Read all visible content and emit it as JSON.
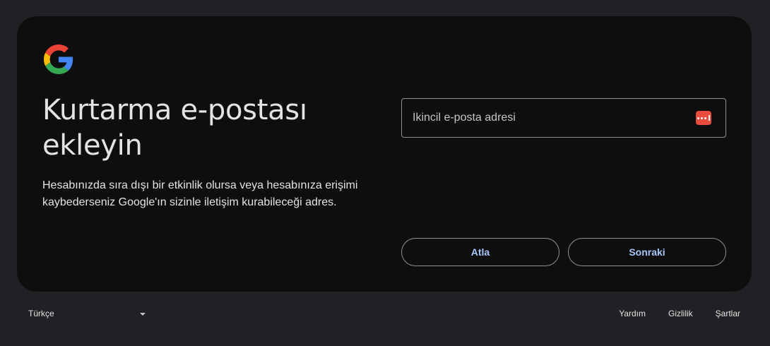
{
  "card": {
    "logo_icon": "google-g-logo",
    "title": "Kurtarma e-postası ekleyin",
    "description": "Hesabınızda sıra dışı bir etkinlik olursa veya hesabınıza erişimi kaybederseniz Google'ın sizinle iletişim kurabileceği adres.",
    "email_field": {
      "value": "",
      "placeholder": "İkincil e-posta adresi",
      "icon": "password-manager-icon"
    },
    "skip_label": "Atla",
    "next_label": "Sonraki"
  },
  "footer": {
    "language": "Türkçe",
    "links": {
      "help": "Yardım",
      "privacy": "Gizlilik",
      "terms": "Şartlar"
    }
  },
  "colors": {
    "page_background": "#202124",
    "card_background": "#0e0e0e",
    "button_text": "#a8c7fa",
    "border": "#8e918f",
    "password_icon": "#e74c3c"
  }
}
